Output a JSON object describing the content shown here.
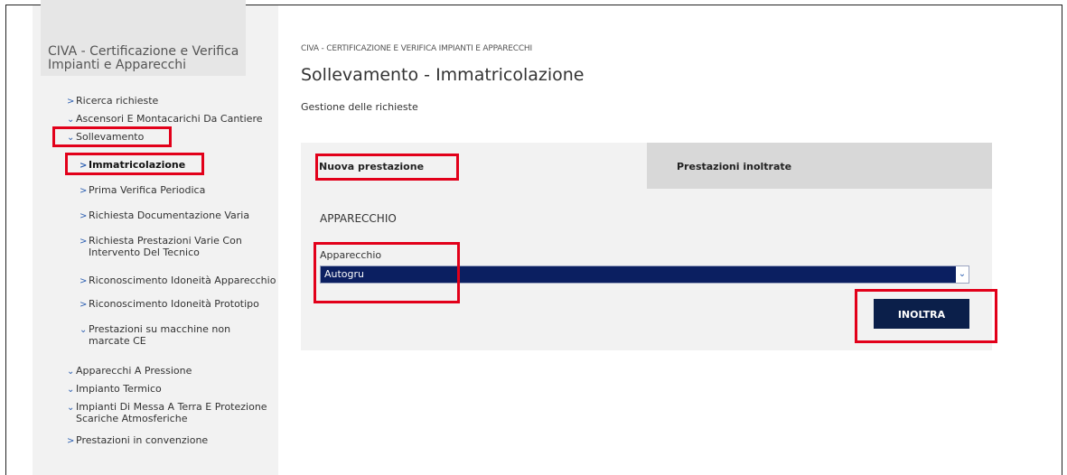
{
  "sidebar": {
    "title": "CIVA - Certificazione e Verifica Impianti e Apparecchi",
    "items": [
      {
        "chevron": ">",
        "label": "Ricerca richieste"
      },
      {
        "chevron": "⌄",
        "label": "Ascensori E Montacarichi Da Cantiere"
      },
      {
        "chevron": "⌄",
        "label": "Sollevamento"
      },
      {
        "chevron": ">",
        "label": "Immatricolazione"
      },
      {
        "chevron": ">",
        "label": "Prima Verifica Periodica"
      },
      {
        "chevron": ">",
        "label": "Richiesta Documentazione Varia"
      },
      {
        "chevron": ">",
        "label": "Richiesta Prestazioni Varie Con Intervento Del Tecnico"
      },
      {
        "chevron": ">",
        "label": "Riconoscimento Idoneità Apparecchio"
      },
      {
        "chevron": ">",
        "label": "Riconoscimento Idoneità Prototipo"
      },
      {
        "chevron": "⌄",
        "label": "Prestazioni su macchine non marcate CE"
      },
      {
        "chevron": "⌄",
        "label": "Apparecchi A Pressione"
      },
      {
        "chevron": "⌄",
        "label": "Impianto Termico"
      },
      {
        "chevron": "⌄",
        "label": "Impianti Di Messa A Terra E Protezione Scariche Atmosferiche"
      },
      {
        "chevron": ">",
        "label": "Prestazioni in convenzione"
      }
    ]
  },
  "main": {
    "breadcrumb": "CIVA - CERTIFICAZIONE E VERIFICA IMPIANTI E APPARECCHI",
    "title": "Sollevamento - Immatricolazione",
    "subtitle": "Gestione delle richieste",
    "tabs": [
      {
        "label": "Nuova prestazione"
      },
      {
        "label": "Prestazioni inoltrate"
      }
    ],
    "section_label": "APPARECCHIO",
    "field_label": "Apparecchio",
    "select_value": "Autogru",
    "submit_label": "INOLTRA"
  },
  "colors": {
    "highlight": "#e2001a",
    "select_bg": "#0b1f61",
    "button_bg": "#0b1f4a",
    "chevron": "#2a5db0"
  }
}
